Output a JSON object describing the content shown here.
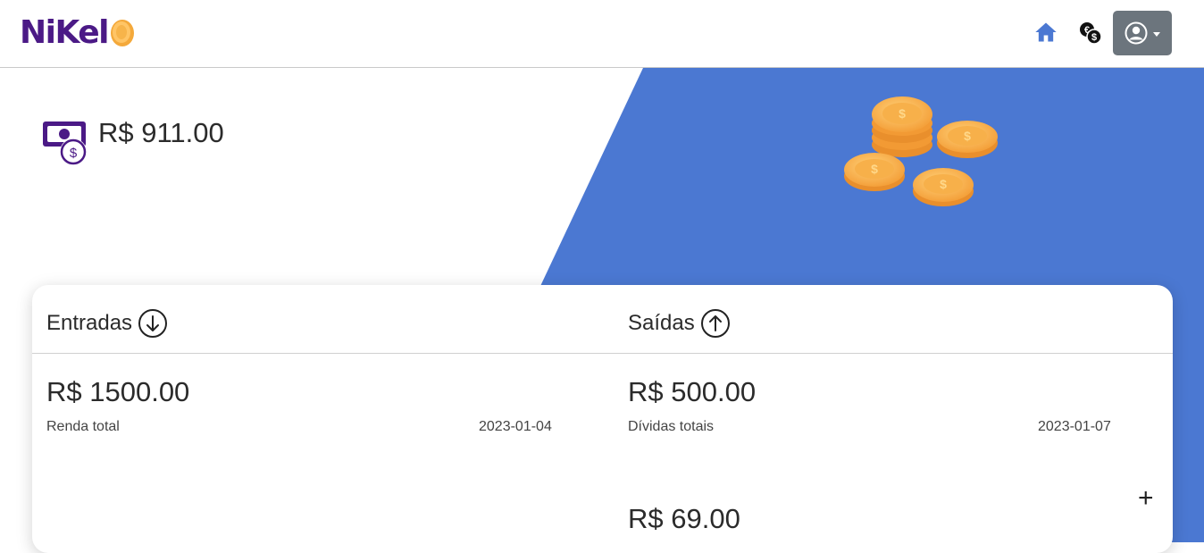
{
  "brand": {
    "name": "NiKel"
  },
  "nav": {
    "home_icon": "home-icon",
    "transactions_icon": "money-exchange-icon",
    "user_icon": "user-circle-icon"
  },
  "balance": {
    "value": "R$ 911.00",
    "icon": "money-bill-icon"
  },
  "colors": {
    "accent_blue": "#4b78d2",
    "brand_purple": "#4b1a86",
    "user_button": "#6c757d"
  },
  "entradas": {
    "title": "Entradas",
    "items": [
      {
        "amount": "R$ 1500.00",
        "description": "Renda total",
        "date": "2023-01-04"
      }
    ]
  },
  "saidas": {
    "title": "Saídas",
    "items": [
      {
        "amount": "R$ 500.00",
        "description": "Dívidas totais",
        "date": "2023-01-07"
      },
      {
        "amount": "R$ 69.00"
      }
    ]
  },
  "add_button": {
    "label": "+"
  }
}
